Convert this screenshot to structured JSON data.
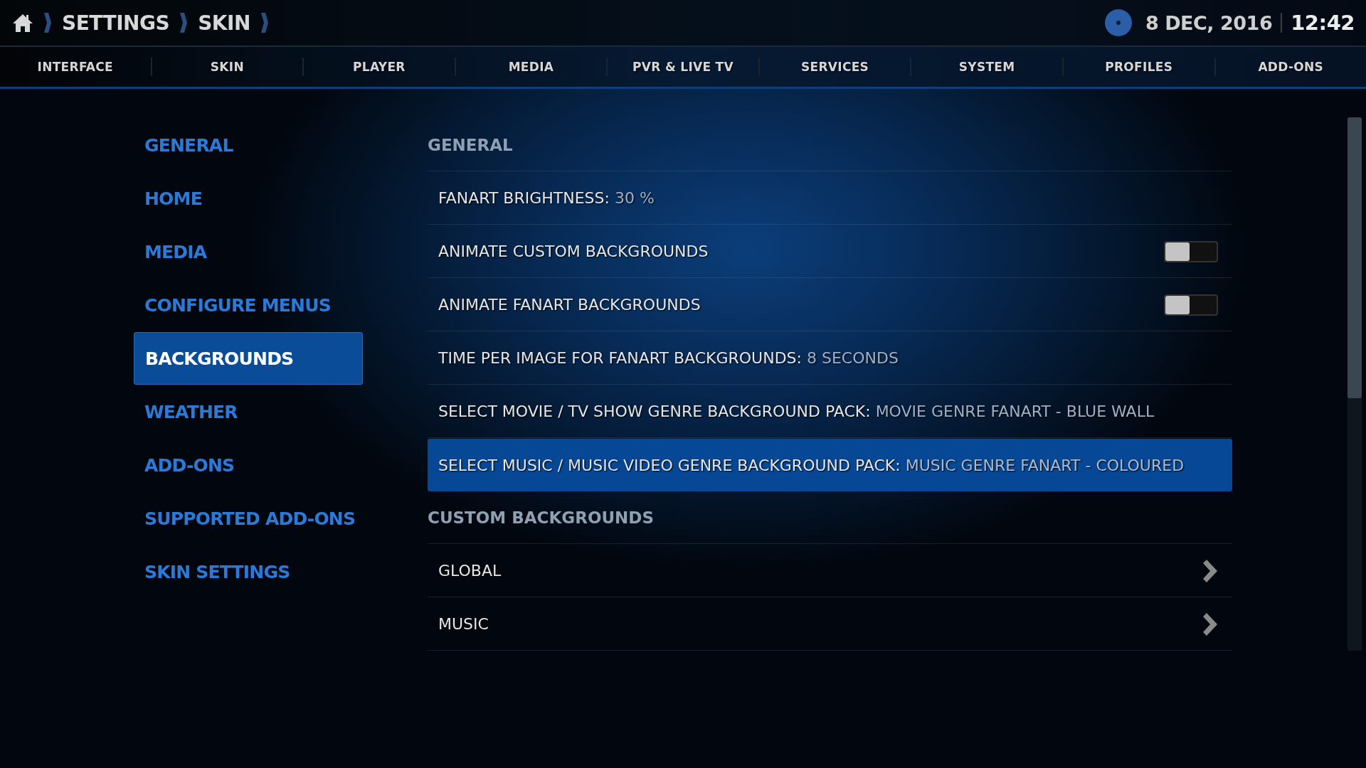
{
  "breadcrumb": [
    "SETTINGS",
    "SKIN"
  ],
  "clock": {
    "date": "8 DEC, 2016",
    "time": "12:42"
  },
  "tabs": [
    {
      "label": "INTERFACE",
      "selected": false
    },
    {
      "label": "SKIN",
      "selected": false
    },
    {
      "label": "PLAYER",
      "selected": false
    },
    {
      "label": "MEDIA",
      "selected": false
    },
    {
      "label": "PVR & LIVE TV",
      "selected": false
    },
    {
      "label": "SERVICES",
      "selected": false
    },
    {
      "label": "SYSTEM",
      "selected": false
    },
    {
      "label": "PROFILES",
      "selected": false
    },
    {
      "label": "ADD-ONS",
      "selected": false
    }
  ],
  "sidebar": {
    "items": [
      {
        "label": "GENERAL",
        "selected": false
      },
      {
        "label": "HOME",
        "selected": false
      },
      {
        "label": "MEDIA",
        "selected": false
      },
      {
        "label": "CONFIGURE MENUS",
        "selected": false
      },
      {
        "label": "BACKGROUNDS",
        "selected": true
      },
      {
        "label": "WEATHER",
        "selected": false
      },
      {
        "label": "ADD-ONS",
        "selected": false
      },
      {
        "label": "SUPPORTED ADD-ONS",
        "selected": false
      },
      {
        "label": "SKIN SETTINGS",
        "selected": false
      }
    ]
  },
  "settings": [
    {
      "kind": "header",
      "label": "GENERAL"
    },
    {
      "kind": "value",
      "label": "FANART BRIGHTNESS:",
      "value": "30 %",
      "selected": false
    },
    {
      "kind": "toggle",
      "label": "ANIMATE CUSTOM BACKGROUNDS",
      "on": false,
      "selected": false
    },
    {
      "kind": "toggle",
      "label": "ANIMATE FANART BACKGROUNDS",
      "on": false,
      "selected": false
    },
    {
      "kind": "value",
      "label": "TIME PER IMAGE FOR FANART BACKGROUNDS:",
      "value": "8 SECONDS",
      "selected": false
    },
    {
      "kind": "value",
      "label": "SELECT MOVIE / TV SHOW GENRE BACKGROUND PACK:",
      "value": "MOVIE GENRE FANART - BLUE WALL",
      "selected": false
    },
    {
      "kind": "value",
      "label": "SELECT MUSIC / MUSIC VIDEO GENRE BACKGROUND PACK:",
      "value": "MUSIC GENRE FANART - COLOURED",
      "selected": true
    },
    {
      "kind": "header",
      "label": "CUSTOM BACKGROUNDS"
    },
    {
      "kind": "link",
      "label": "GLOBAL",
      "selected": false
    },
    {
      "kind": "link",
      "label": "MUSIC",
      "selected": false
    }
  ]
}
